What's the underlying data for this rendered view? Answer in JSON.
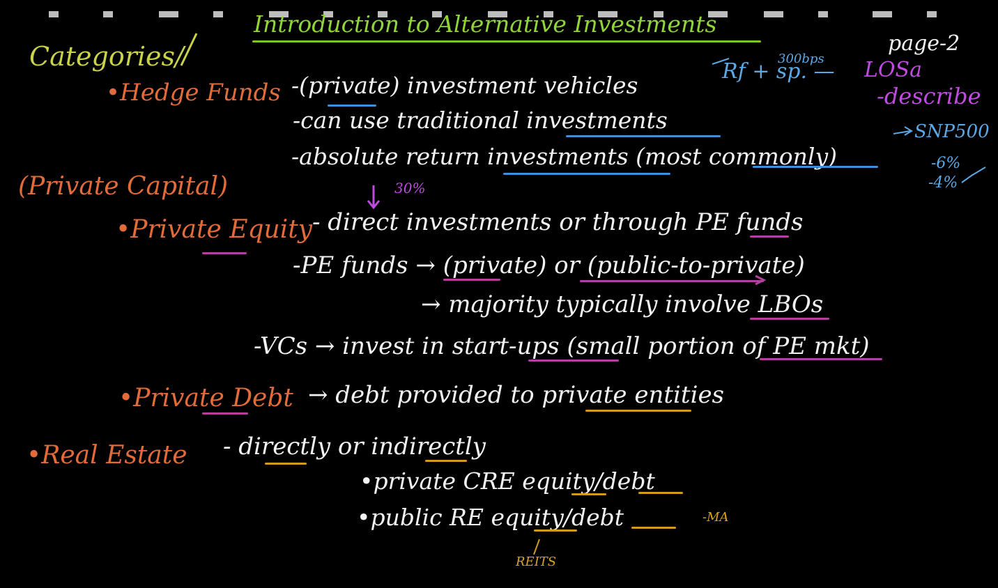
{
  "title": "Introduction to Alternative Investments",
  "page": "page-2",
  "annotations": {
    "rf_sp": "Rf + sp. —",
    "bps": "300bps",
    "los": "LOSa",
    "describe": "-describe",
    "snp": "SNP500",
    "six": "-6%",
    "four": "-4%",
    "thirty_six": "30%",
    "reits": "REITS",
    "ma": "-MA"
  },
  "categories_heading": "Categories/",
  "private_capital": "(Private Capital)",
  "hedge_funds": {
    "label": "•Hedge Funds",
    "lines": [
      "-(private) investment vehicles",
      "-can use traditional investments",
      "-absolute return investments (most commonly)"
    ]
  },
  "private_equity": {
    "label": "•Private Equity",
    "lines": [
      "- direct investments or through PE funds",
      "-PE funds → (private) or (public-to-private)",
      "→ majority typically involve LBOs",
      "-VCs → invest in start-ups (small portion of PE mkt)"
    ]
  },
  "private_debt": {
    "label": "•Private Debt",
    "line": "→ debt provided to private entities"
  },
  "real_estate": {
    "label": "•Real Estate",
    "lines": [
      "- directly or indirectly",
      "•private CRE equity/debt",
      "•public RE equity/debt"
    ]
  }
}
